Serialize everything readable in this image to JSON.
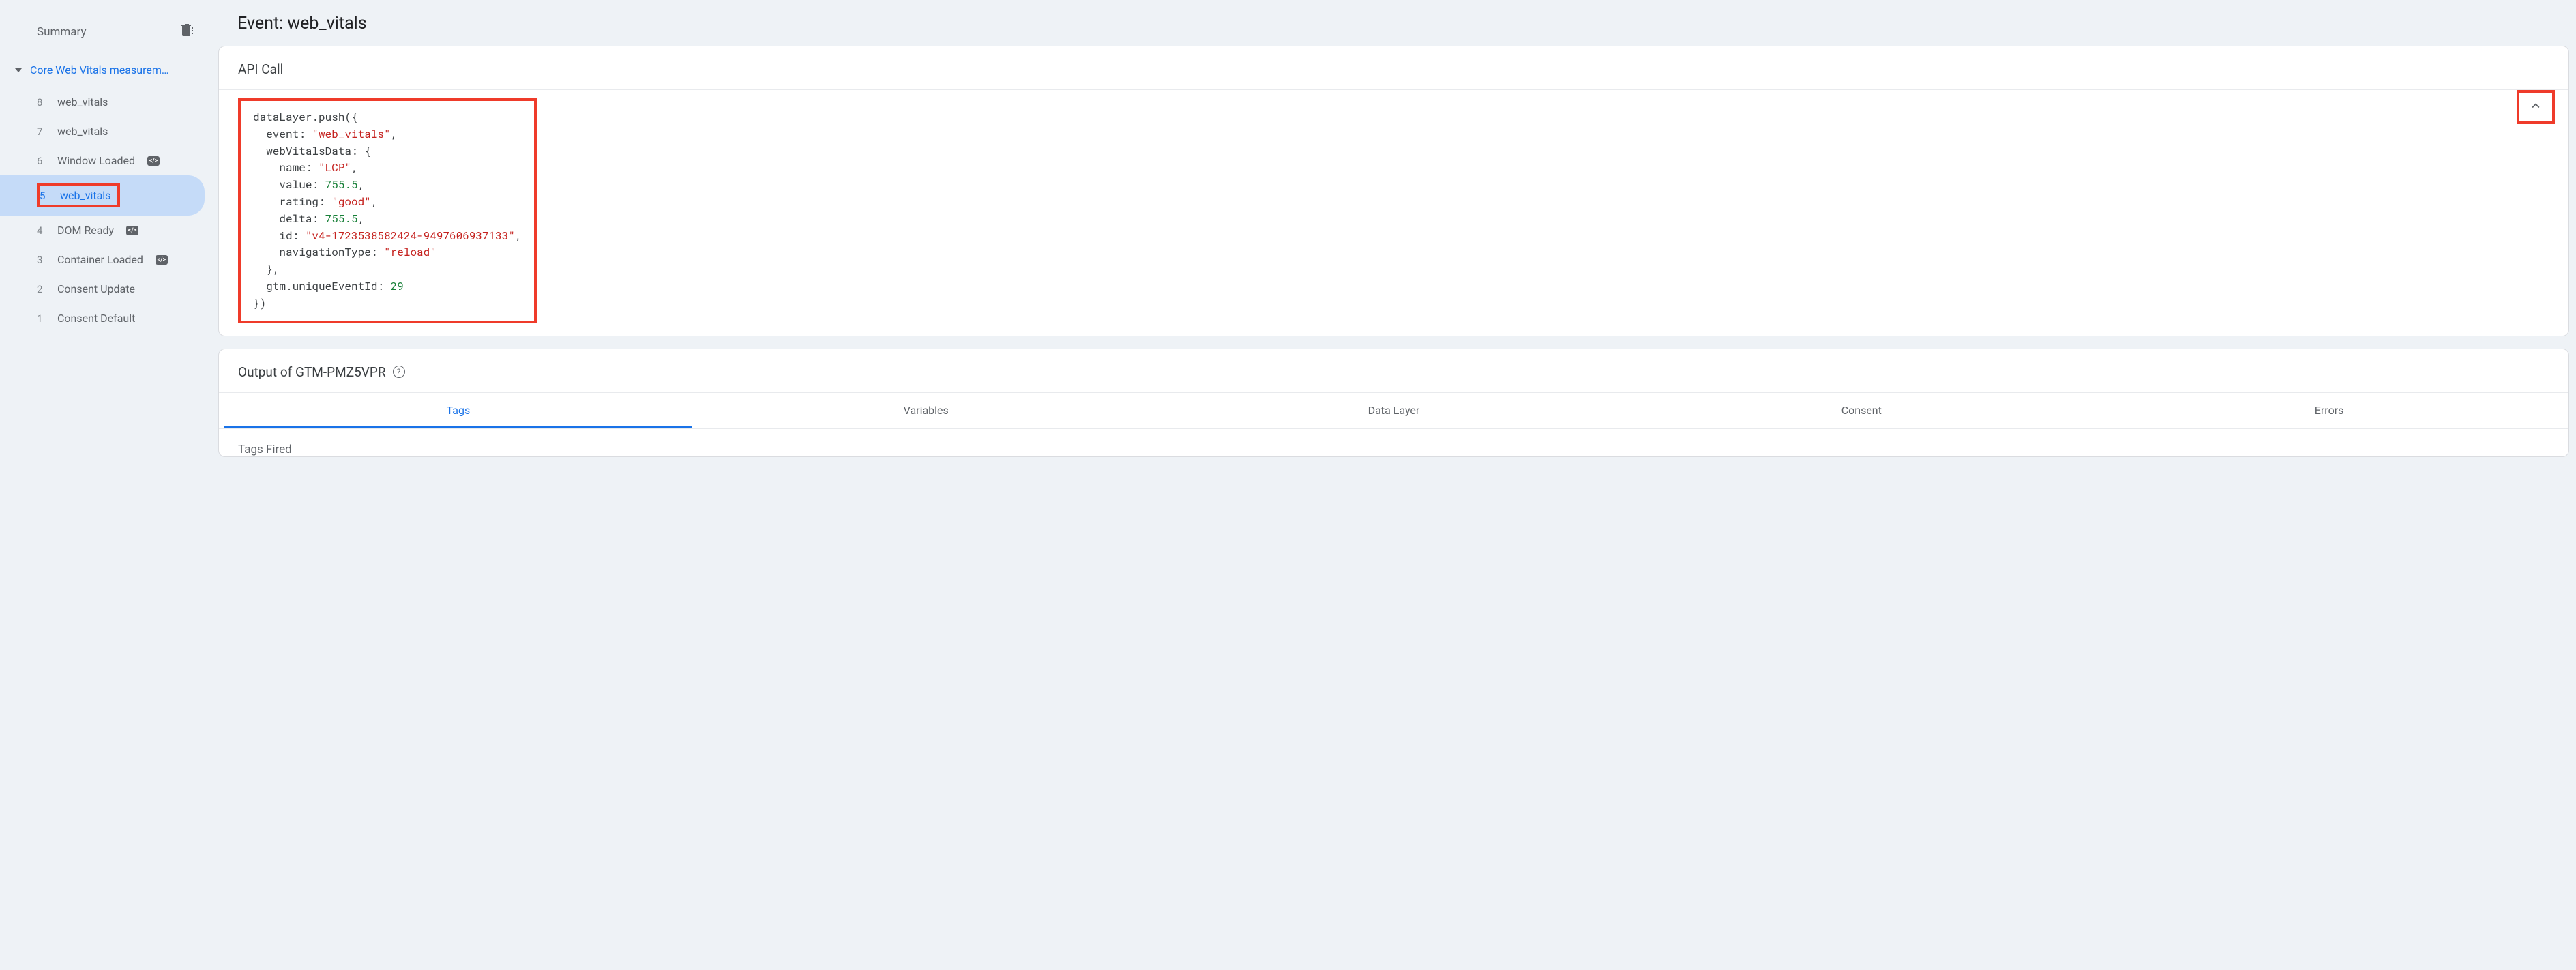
{
  "sidebar": {
    "summary_label": "Summary",
    "group_title": "Core Web Vitals measurem…",
    "events": [
      {
        "num": "8",
        "label": "web_vitals",
        "badge": false
      },
      {
        "num": "7",
        "label": "web_vitals",
        "badge": false
      },
      {
        "num": "6",
        "label": "Window Loaded",
        "badge": true
      },
      {
        "num": "5",
        "label": "web_vitals",
        "badge": false,
        "selected": true
      },
      {
        "num": "4",
        "label": "DOM Ready",
        "badge": true
      },
      {
        "num": "3",
        "label": "Container Loaded",
        "badge": true
      },
      {
        "num": "2",
        "label": "Consent Update",
        "badge": false
      },
      {
        "num": "1",
        "label": "Consent Default",
        "badge": false
      }
    ]
  },
  "main": {
    "title": "Event: web_vitals",
    "api_call_title": "API Call",
    "api_call_code": {
      "fn": "dataLayer.push",
      "event": "web_vitals",
      "webVitalsData": {
        "name": "LCP",
        "value": 755.5,
        "rating": "good",
        "delta": 755.5,
        "id": "v4-1723538582424-9497606937133",
        "navigationType": "reload"
      },
      "gtm_uniqueEventId": 29
    },
    "output_title_prefix": "Output of ",
    "output_container": "GTM-PMZ5VPR",
    "tabs": [
      "Tags",
      "Variables",
      "Data Layer",
      "Consent",
      "Errors"
    ],
    "active_tab": "Tags",
    "tags_fired_title": "Tags Fired"
  }
}
